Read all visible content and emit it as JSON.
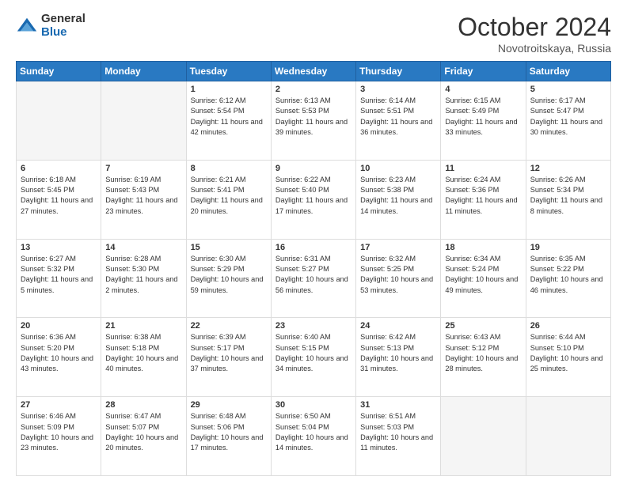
{
  "logo": {
    "general": "General",
    "blue": "Blue"
  },
  "header": {
    "month": "October 2024",
    "location": "Novotroitskaya, Russia"
  },
  "weekdays": [
    "Sunday",
    "Monday",
    "Tuesday",
    "Wednesday",
    "Thursday",
    "Friday",
    "Saturday"
  ],
  "weeks": [
    [
      {
        "day": "",
        "sunrise": "",
        "sunset": "",
        "daylight": "",
        "empty": true
      },
      {
        "day": "",
        "sunrise": "",
        "sunset": "",
        "daylight": "",
        "empty": true
      },
      {
        "day": "1",
        "sunrise": "Sunrise: 6:12 AM",
        "sunset": "Sunset: 5:54 PM",
        "daylight": "Daylight: 11 hours and 42 minutes.",
        "empty": false
      },
      {
        "day": "2",
        "sunrise": "Sunrise: 6:13 AM",
        "sunset": "Sunset: 5:53 PM",
        "daylight": "Daylight: 11 hours and 39 minutes.",
        "empty": false
      },
      {
        "day": "3",
        "sunrise": "Sunrise: 6:14 AM",
        "sunset": "Sunset: 5:51 PM",
        "daylight": "Daylight: 11 hours and 36 minutes.",
        "empty": false
      },
      {
        "day": "4",
        "sunrise": "Sunrise: 6:15 AM",
        "sunset": "Sunset: 5:49 PM",
        "daylight": "Daylight: 11 hours and 33 minutes.",
        "empty": false
      },
      {
        "day": "5",
        "sunrise": "Sunrise: 6:17 AM",
        "sunset": "Sunset: 5:47 PM",
        "daylight": "Daylight: 11 hours and 30 minutes.",
        "empty": false
      }
    ],
    [
      {
        "day": "6",
        "sunrise": "Sunrise: 6:18 AM",
        "sunset": "Sunset: 5:45 PM",
        "daylight": "Daylight: 11 hours and 27 minutes.",
        "empty": false
      },
      {
        "day": "7",
        "sunrise": "Sunrise: 6:19 AM",
        "sunset": "Sunset: 5:43 PM",
        "daylight": "Daylight: 11 hours and 23 minutes.",
        "empty": false
      },
      {
        "day": "8",
        "sunrise": "Sunrise: 6:21 AM",
        "sunset": "Sunset: 5:41 PM",
        "daylight": "Daylight: 11 hours and 20 minutes.",
        "empty": false
      },
      {
        "day": "9",
        "sunrise": "Sunrise: 6:22 AM",
        "sunset": "Sunset: 5:40 PM",
        "daylight": "Daylight: 11 hours and 17 minutes.",
        "empty": false
      },
      {
        "day": "10",
        "sunrise": "Sunrise: 6:23 AM",
        "sunset": "Sunset: 5:38 PM",
        "daylight": "Daylight: 11 hours and 14 minutes.",
        "empty": false
      },
      {
        "day": "11",
        "sunrise": "Sunrise: 6:24 AM",
        "sunset": "Sunset: 5:36 PM",
        "daylight": "Daylight: 11 hours and 11 minutes.",
        "empty": false
      },
      {
        "day": "12",
        "sunrise": "Sunrise: 6:26 AM",
        "sunset": "Sunset: 5:34 PM",
        "daylight": "Daylight: 11 hours and 8 minutes.",
        "empty": false
      }
    ],
    [
      {
        "day": "13",
        "sunrise": "Sunrise: 6:27 AM",
        "sunset": "Sunset: 5:32 PM",
        "daylight": "Daylight: 11 hours and 5 minutes.",
        "empty": false
      },
      {
        "day": "14",
        "sunrise": "Sunrise: 6:28 AM",
        "sunset": "Sunset: 5:30 PM",
        "daylight": "Daylight: 11 hours and 2 minutes.",
        "empty": false
      },
      {
        "day": "15",
        "sunrise": "Sunrise: 6:30 AM",
        "sunset": "Sunset: 5:29 PM",
        "daylight": "Daylight: 10 hours and 59 minutes.",
        "empty": false
      },
      {
        "day": "16",
        "sunrise": "Sunrise: 6:31 AM",
        "sunset": "Sunset: 5:27 PM",
        "daylight": "Daylight: 10 hours and 56 minutes.",
        "empty": false
      },
      {
        "day": "17",
        "sunrise": "Sunrise: 6:32 AM",
        "sunset": "Sunset: 5:25 PM",
        "daylight": "Daylight: 10 hours and 53 minutes.",
        "empty": false
      },
      {
        "day": "18",
        "sunrise": "Sunrise: 6:34 AM",
        "sunset": "Sunset: 5:24 PM",
        "daylight": "Daylight: 10 hours and 49 minutes.",
        "empty": false
      },
      {
        "day": "19",
        "sunrise": "Sunrise: 6:35 AM",
        "sunset": "Sunset: 5:22 PM",
        "daylight": "Daylight: 10 hours and 46 minutes.",
        "empty": false
      }
    ],
    [
      {
        "day": "20",
        "sunrise": "Sunrise: 6:36 AM",
        "sunset": "Sunset: 5:20 PM",
        "daylight": "Daylight: 10 hours and 43 minutes.",
        "empty": false
      },
      {
        "day": "21",
        "sunrise": "Sunrise: 6:38 AM",
        "sunset": "Sunset: 5:18 PM",
        "daylight": "Daylight: 10 hours and 40 minutes.",
        "empty": false
      },
      {
        "day": "22",
        "sunrise": "Sunrise: 6:39 AM",
        "sunset": "Sunset: 5:17 PM",
        "daylight": "Daylight: 10 hours and 37 minutes.",
        "empty": false
      },
      {
        "day": "23",
        "sunrise": "Sunrise: 6:40 AM",
        "sunset": "Sunset: 5:15 PM",
        "daylight": "Daylight: 10 hours and 34 minutes.",
        "empty": false
      },
      {
        "day": "24",
        "sunrise": "Sunrise: 6:42 AM",
        "sunset": "Sunset: 5:13 PM",
        "daylight": "Daylight: 10 hours and 31 minutes.",
        "empty": false
      },
      {
        "day": "25",
        "sunrise": "Sunrise: 6:43 AM",
        "sunset": "Sunset: 5:12 PM",
        "daylight": "Daylight: 10 hours and 28 minutes.",
        "empty": false
      },
      {
        "day": "26",
        "sunrise": "Sunrise: 6:44 AM",
        "sunset": "Sunset: 5:10 PM",
        "daylight": "Daylight: 10 hours and 25 minutes.",
        "empty": false
      }
    ],
    [
      {
        "day": "27",
        "sunrise": "Sunrise: 6:46 AM",
        "sunset": "Sunset: 5:09 PM",
        "daylight": "Daylight: 10 hours and 23 minutes.",
        "empty": false
      },
      {
        "day": "28",
        "sunrise": "Sunrise: 6:47 AM",
        "sunset": "Sunset: 5:07 PM",
        "daylight": "Daylight: 10 hours and 20 minutes.",
        "empty": false
      },
      {
        "day": "29",
        "sunrise": "Sunrise: 6:48 AM",
        "sunset": "Sunset: 5:06 PM",
        "daylight": "Daylight: 10 hours and 17 minutes.",
        "empty": false
      },
      {
        "day": "30",
        "sunrise": "Sunrise: 6:50 AM",
        "sunset": "Sunset: 5:04 PM",
        "daylight": "Daylight: 10 hours and 14 minutes.",
        "empty": false
      },
      {
        "day": "31",
        "sunrise": "Sunrise: 6:51 AM",
        "sunset": "Sunset: 5:03 PM",
        "daylight": "Daylight: 10 hours and 11 minutes.",
        "empty": false
      },
      {
        "day": "",
        "sunrise": "",
        "sunset": "",
        "daylight": "",
        "empty": true
      },
      {
        "day": "",
        "sunrise": "",
        "sunset": "",
        "daylight": "",
        "empty": true
      }
    ]
  ]
}
